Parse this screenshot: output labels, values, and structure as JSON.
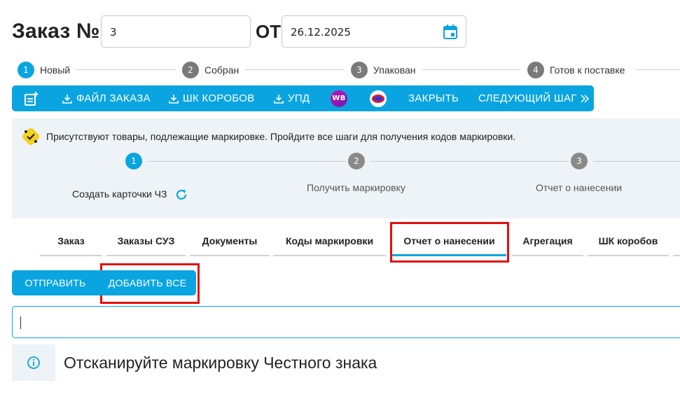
{
  "header": {
    "title": "Заказ №",
    "order_number": "3",
    "from_label": "ОТ",
    "date": "26.12.2025"
  },
  "stepper": [
    {
      "num": "1",
      "label": "Новый",
      "active": true
    },
    {
      "num": "2",
      "label": "Собран",
      "active": false
    },
    {
      "num": "3",
      "label": "Упакован",
      "active": false
    },
    {
      "num": "4",
      "label": "Готов к поставке",
      "active": false
    }
  ],
  "toolbar": {
    "order_file": "ФАЙЛ ЗАКАЗА",
    "box_barcodes": "ШК КОРОБОВ",
    "upd": "УПД",
    "wb_badge": "WB",
    "close": "ЗАКРЫТЬ",
    "next_step": "СЛЕДУЮЩИЙ ШАГ"
  },
  "marking_panel": {
    "note": "Присутствуют товары, подлежащие маркировке. Пройдите все шаги для получения кодов маркировки.",
    "steps": [
      {
        "num": "1",
        "label": "Создать карточки ЧЗ"
      },
      {
        "num": "2",
        "label": "Получить маркировку"
      },
      {
        "num": "3",
        "label": "Отчет о нанесении"
      }
    ]
  },
  "tabs": [
    {
      "label": "Заказ"
    },
    {
      "label": "Заказы СУЗ"
    },
    {
      "label": "Документы"
    },
    {
      "label": "Коды маркировки"
    },
    {
      "label": "Отчет о нанесении",
      "active": true
    },
    {
      "label": "Агрегация"
    },
    {
      "label": "ШК коробов"
    }
  ],
  "actions": {
    "send": "ОТПРАВИТЬ",
    "add_all": "ДОБАВИТЬ ВСЕ"
  },
  "scan": {
    "value": "",
    "message": "Отсканируйте маркировку Честного знака"
  },
  "colors": {
    "accent": "#0aa5e0",
    "highlight": "#e30f0f",
    "panel_bg": "#eef3f8"
  }
}
